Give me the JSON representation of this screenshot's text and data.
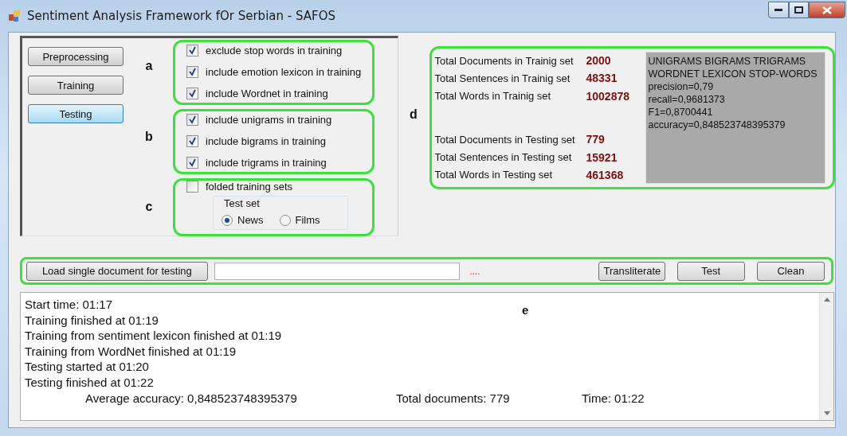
{
  "window": {
    "title": "Sentiment Analysis Framework fOr Serbian - SAFOS"
  },
  "nav_buttons": [
    {
      "label": "Preprocessing",
      "selected": false
    },
    {
      "label": "Training",
      "selected": false
    },
    {
      "label": "Testing",
      "selected": true
    }
  ],
  "option_groups": [
    {
      "marker": "a",
      "options": [
        {
          "label": "exclude stop words in training",
          "checked": true
        },
        {
          "label": "include emotion lexicon in training",
          "checked": true
        },
        {
          "label": "include Wordnet in training",
          "checked": true
        }
      ]
    },
    {
      "marker": "b",
      "options": [
        {
          "label": "include unigrams in training",
          "checked": true
        },
        {
          "label": "include bigrams in training",
          "checked": true
        },
        {
          "label": "include trigrams in training",
          "checked": true
        }
      ]
    }
  ],
  "folding_group": {
    "marker": "c",
    "checkbox": {
      "label": "folded training sets",
      "checked": false
    },
    "test_set": {
      "title": "Test set",
      "options": [
        {
          "label": "News",
          "selected": true
        },
        {
          "label": "Films",
          "selected": false
        }
      ]
    }
  },
  "stats": {
    "marker": "d",
    "training": [
      {
        "label": "Total Documents in Trainig set",
        "value": "2000"
      },
      {
        "label": "Total Sentences in Trainig set",
        "value": "48331"
      },
      {
        "label": "Total Words in Trainig set",
        "value": "1002878"
      }
    ],
    "testing": [
      {
        "label": "Total Documents in Testing set",
        "value": "779"
      },
      {
        "label": "Total Sentences in Testing set",
        "value": "15921"
      },
      {
        "label": "Total Words in Testing set",
        "value": "461368"
      }
    ],
    "results": [
      "UNIGRAMS BIGRAMS TRIGRAMS",
      "WORDNET LEXICON STOP-WORDS",
      "precision=0,79",
      "recall=0,9681373",
      "F1=0,8700441",
      "accuracy=0,848523748395379"
    ]
  },
  "toolbar": {
    "load_button": "Load single document for testing",
    "status": "....",
    "buttons": [
      "Transliterate",
      "Test",
      "Clean"
    ]
  },
  "log": {
    "marker": "e",
    "lines": [
      "Start time: 01:17",
      "Training finished at 01:19",
      "Training from sentiment lexicon finished at 01:19",
      "Training from WordNet finished at 01:19",
      "Testing started at 01:20",
      "Testing finished at 01:22"
    ],
    "summary": [
      "Average accuracy: 0,848523748395379",
      "Total documents: 779",
      "Time: 01:22"
    ]
  }
}
